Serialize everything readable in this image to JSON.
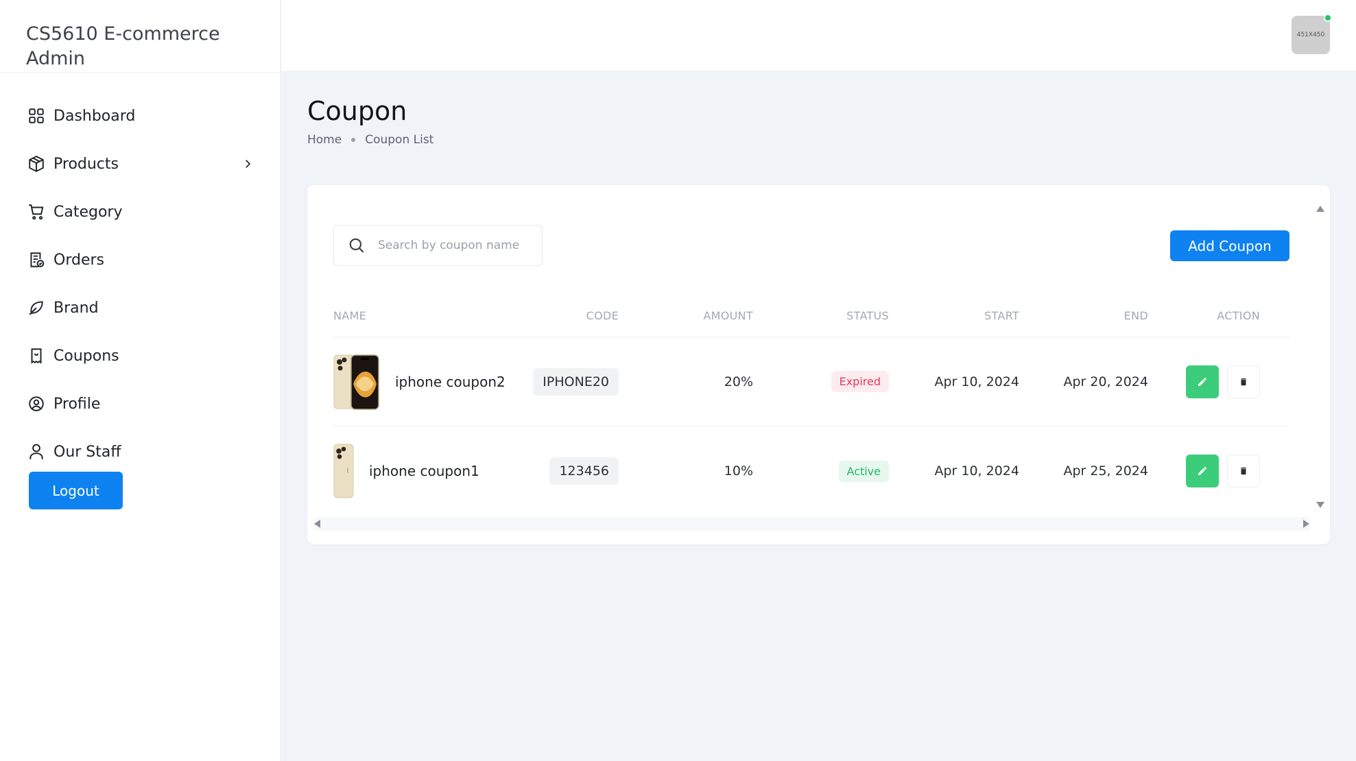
{
  "sidebar": {
    "brand_title": "CS5610 E-commerce Admin",
    "items": [
      {
        "label": "Dashboard",
        "icon": "dashboard-grid-icon"
      },
      {
        "label": "Products",
        "icon": "box-icon",
        "has_submenu": true
      },
      {
        "label": "Category",
        "icon": "cart-icon"
      },
      {
        "label": "Orders",
        "icon": "orders-icon"
      },
      {
        "label": "Brand",
        "icon": "leaf-icon"
      },
      {
        "label": "Coupons",
        "icon": "coupon-icon"
      },
      {
        "label": "Profile",
        "icon": "profile-circle-icon"
      },
      {
        "label": "Our Staff",
        "icon": "user-icon"
      }
    ],
    "logout_label": "Logout"
  },
  "header": {
    "avatar_text": "451X450",
    "online_status_color": "#1fc46a"
  },
  "main": {
    "title": "Coupon",
    "breadcrumb": [
      "Home",
      "Coupon List"
    ],
    "search_placeholder": "Search by coupon name",
    "add_button_label": "Add Coupon",
    "columns": [
      "NAME",
      "CODE",
      "AMOUNT",
      "STATUS",
      "START",
      "END",
      "ACTION"
    ],
    "rows": [
      {
        "name": "iphone coupon2",
        "code": "IPHONE20",
        "amount": "20%",
        "status": "Expired",
        "start": "Apr 10, 2024",
        "end": "Apr 20, 2024"
      },
      {
        "name": "iphone coupon1",
        "code": "123456",
        "amount": "10%",
        "status": "Active",
        "start": "Apr 10, 2024",
        "end": "Apr 25, 2024"
      }
    ]
  },
  "colors": {
    "accent": "#0e82f0",
    "edit": "#3ccd7a",
    "expired": "#e0395b",
    "active": "#25b56a"
  }
}
